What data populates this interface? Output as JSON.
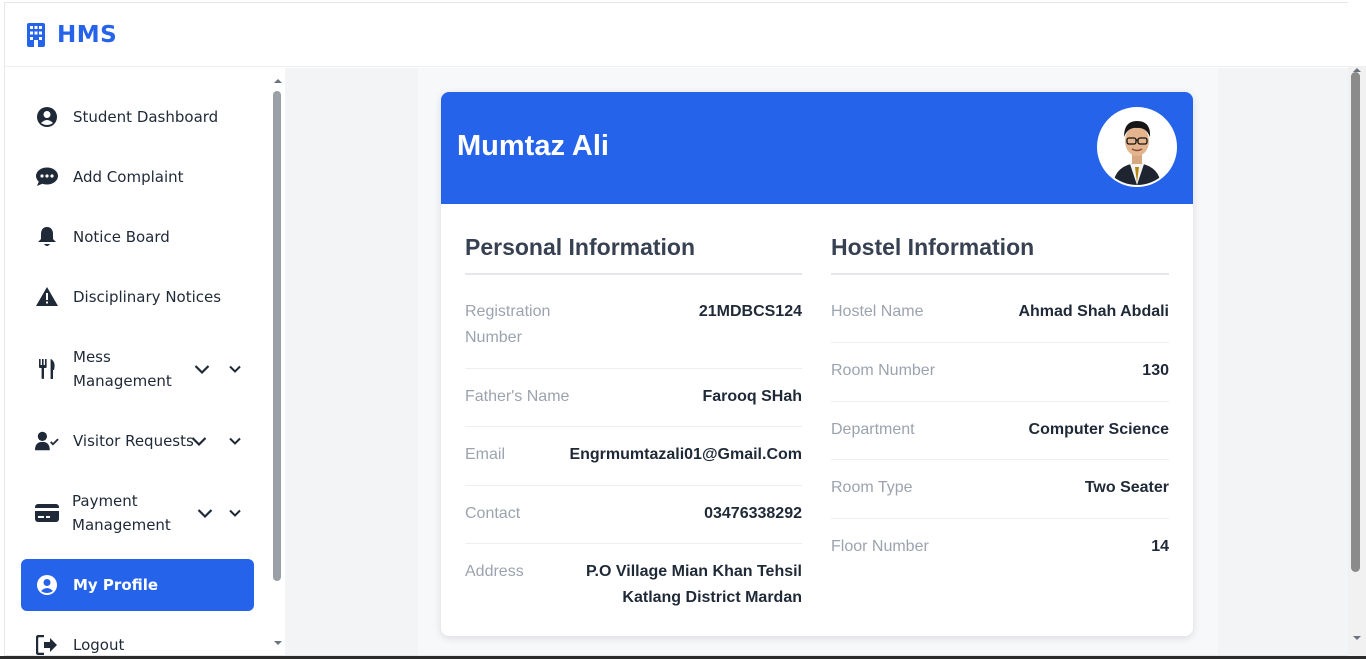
{
  "app": {
    "brand": "HMS"
  },
  "sidebar": {
    "items": [
      {
        "label": "Student Dashboard",
        "icon": "user-circle-icon"
      },
      {
        "label": "Add Complaint",
        "icon": "chat-icon"
      },
      {
        "label": "Notice Board",
        "icon": "bell-icon"
      },
      {
        "label": "Disciplinary Notices",
        "icon": "warning-icon"
      },
      {
        "label": "Mess Management",
        "icon": "utensils-icon"
      },
      {
        "label": "Visitor Requests",
        "icon": "user-check-icon"
      },
      {
        "label": "Payment Management",
        "icon": "credit-card-icon"
      },
      {
        "label": "My Profile",
        "icon": "user-circle-icon",
        "active": true
      },
      {
        "label": "Logout",
        "icon": "logout-icon"
      }
    ]
  },
  "profile": {
    "name": "Mumtaz Ali",
    "personal": {
      "title": "Personal Information",
      "fields": [
        {
          "key": "Registration Number",
          "value": "21MDBCS124"
        },
        {
          "key": "Father's Name",
          "value": "Farooq SHah"
        },
        {
          "key": "Email",
          "value": "Engrmumtazali01@Gmail.Com"
        },
        {
          "key": "Contact",
          "value": "03476338292"
        },
        {
          "key": "Address",
          "value": "P.O Village Mian Khan Tehsil Katlang District Mardan"
        }
      ]
    },
    "hostel": {
      "title": "Hostel Information",
      "fields": [
        {
          "key": "Hostel Name",
          "value": "Ahmad Shah Abdali"
        },
        {
          "key": "Room Number",
          "value": "130"
        },
        {
          "key": "Department",
          "value": "Computer Science"
        },
        {
          "key": "Room Type",
          "value": "Two Seater"
        },
        {
          "key": "Floor Number",
          "value": "14"
        }
      ]
    }
  },
  "colors": {
    "primary": "#2563eb",
    "text": "#1f2937",
    "muted": "#9ca3af"
  }
}
